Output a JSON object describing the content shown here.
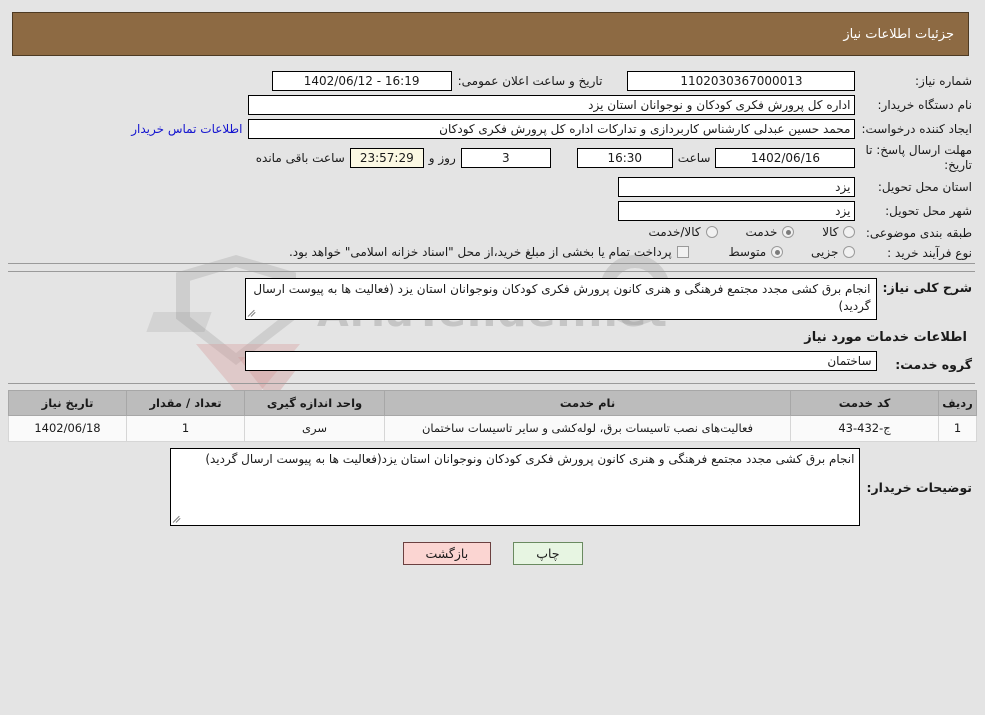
{
  "header": {
    "title": "جزئیات اطلاعات نیاز"
  },
  "form": {
    "need_number_label": "شماره نیاز:",
    "need_number_value": "1102030367000013",
    "announce_datetime_label": "تاریخ و ساعت اعلان عمومی:",
    "announce_datetime_value": "16:19 - 1402/06/12",
    "buyer_org_label": "نام دستگاه خریدار:",
    "buyer_org_value": "اداره کل پرورش فکری کودکان و نوجوانان استان یزد",
    "requester_label": "ایجاد کننده درخواست:",
    "requester_value": "محمد حسین عبدلی کارشناس کاربردازی و تدارکات اداره کل پرورش فکری کودکان",
    "contact_link": "اطلاعات تماس خریدار",
    "deadline_label": "مهلت ارسال پاسخ: تا تاریخ:",
    "deadline_date": "1402/06/16",
    "deadline_hour_label": "ساعت",
    "deadline_hour": "16:30",
    "remaining_days": "3",
    "remaining_days_label": "روز و",
    "remaining_time": "23:57:29",
    "remaining_time_label": "ساعت باقی مانده",
    "province_label": "استان محل تحویل:",
    "province_value": "یزد",
    "city_label": "شهر محل تحویل:",
    "city_value": "یزد",
    "category_label": "طبقه بندی موضوعی:",
    "category_options": [
      {
        "label": "کالا",
        "selected": false
      },
      {
        "label": "خدمت",
        "selected": true
      },
      {
        "label": "کالا/خدمت",
        "selected": false
      }
    ],
    "process_label": "نوع فرآیند خرید :",
    "process_options": [
      {
        "label": "جزیی",
        "selected": false
      },
      {
        "label": "متوسط",
        "selected": true
      }
    ],
    "treasury_checkbox_checked": false,
    "treasury_note": "پرداخت تمام یا بخشی از مبلغ خرید،از محل \"اسناد خزانه اسلامی\" خواهد بود."
  },
  "need_description": {
    "label": "شرح کلی نیاز:",
    "value": "انجام برق کشی مجدد مجتمع فرهنگی و هنری کانون پرورش فکری کودکان ونوجوانان استان یزد (فعالیت ها به پیوست ارسال گردید)"
  },
  "services_section": {
    "title": "اطلاعات خدمات مورد نیاز",
    "service_group_label": "گروه خدمت:",
    "service_group_value": "ساختمان"
  },
  "table": {
    "columns": [
      "ردیف",
      "کد خدمت",
      "نام خدمت",
      "واحد اندازه گیری",
      "تعداد / مقدار",
      "تاریخ نیاز"
    ],
    "rows": [
      {
        "row_no": "1",
        "service_code": "ج-432-43",
        "service_name": "فعالیت‌های نصب تاسیسات برق، لوله‌کشی و سایر تاسیسات ساختمان",
        "unit": "سری",
        "quantity": "1",
        "need_date": "1402/06/18"
      }
    ]
  },
  "buyer_notes": {
    "label": "توضیحات خریدار:",
    "value": "انجام برق کشی مجدد مجتمع فرهنگی و هنری کانون پرورش فکری کودکان ونوجوانان استان یزد(فعالیت ها به پیوست ارسال گردید)"
  },
  "buttons": {
    "print": "چاپ",
    "back": "بازگشت"
  },
  "watermark": {
    "text": "AriaTender.net"
  },
  "colors": {
    "header_bg": "#8d6a43",
    "page_bg": "#e4e4e4",
    "link": "#1313cf",
    "table_header_bg": "#bcbcbc",
    "print_btn_bg": "#e7f5e2",
    "back_btn_bg": "#fbd5d2",
    "highlight_field_bg": "#fbf8e3"
  }
}
